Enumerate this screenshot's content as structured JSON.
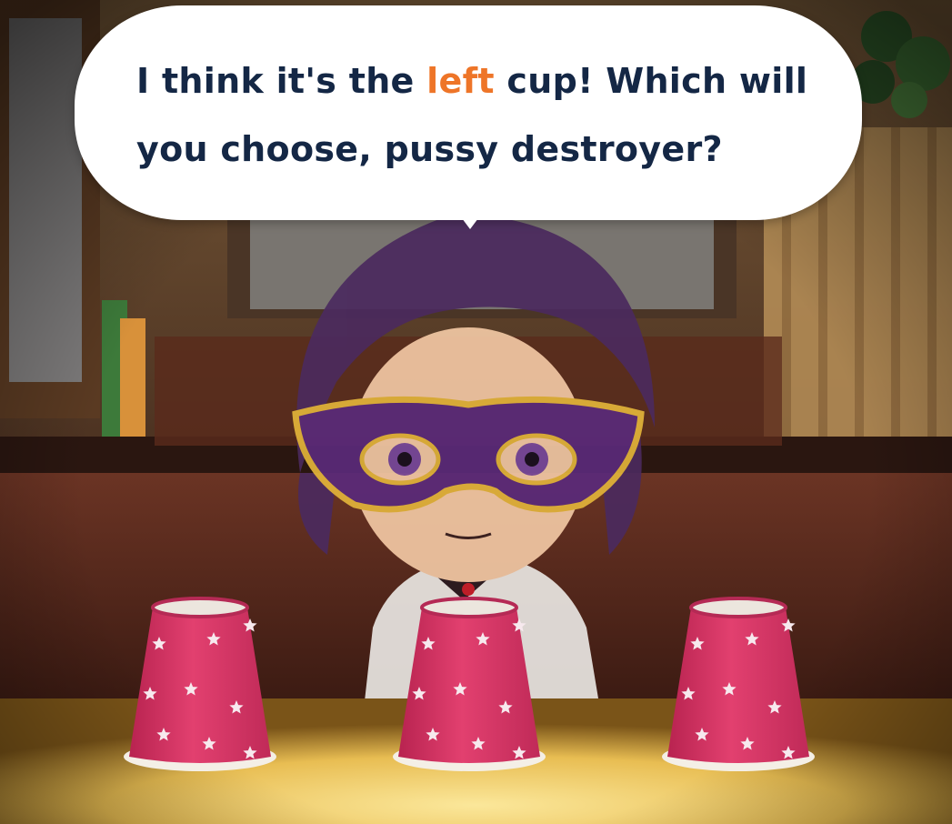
{
  "dialogue": {
    "line1_before": "I think it's the ",
    "highlight": "left",
    "line1_after": " cup! Which will",
    "line2": "you choose, pussy destroyer?"
  },
  "colors": {
    "dialogue_text": "#142745",
    "highlight_text": "#ee7528",
    "cup": "#d8386a",
    "table": "#f3d36b"
  },
  "cups": [
    {
      "name": "left cup"
    },
    {
      "name": "middle cup"
    },
    {
      "name": "right cup"
    }
  ]
}
